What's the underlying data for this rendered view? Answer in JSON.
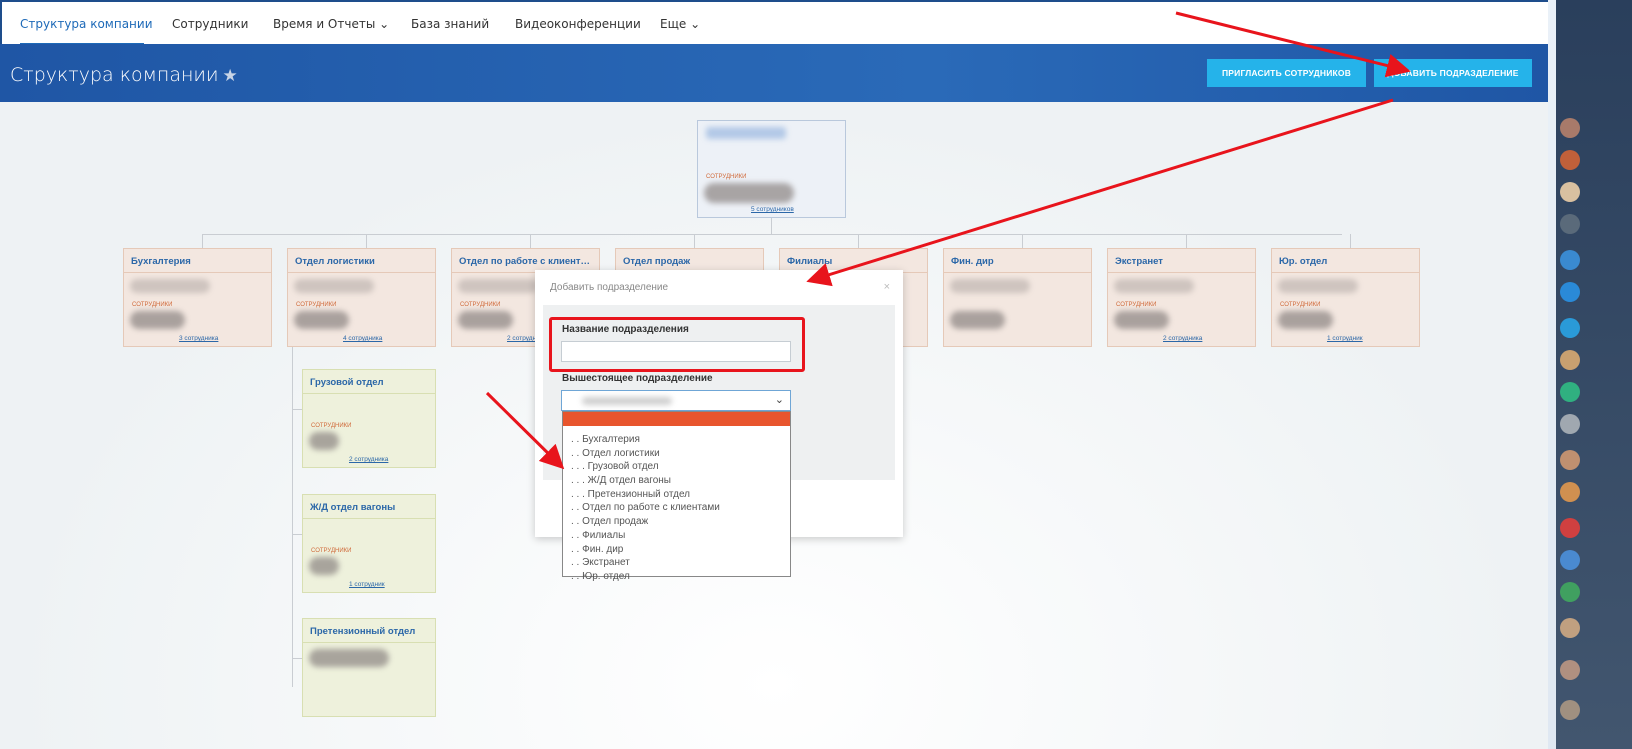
{
  "nav": {
    "items": [
      {
        "label": "Структура компании",
        "active": true
      },
      {
        "label": "Сотрудники"
      },
      {
        "label": "Время и Отчеты",
        "dropdown": true
      },
      {
        "label": "База знаний"
      },
      {
        "label": "Видеоконференции"
      },
      {
        "label": "Еще",
        "dropdown": true
      }
    ]
  },
  "header": {
    "title": "Структура компании",
    "star_icon": "star-icon",
    "invite_button": "ПРИГЛАСИТЬ СОТРУДНИКОВ",
    "add_button": "ДОБАВИТЬ ПОДРАЗДЕЛЕНИЕ",
    "button_color": "#25b3ea"
  },
  "org": {
    "root": {
      "label": "СОТРУДНИКИ",
      "count": "5 сотрудников"
    },
    "departments": [
      {
        "name": "Бухгалтерия",
        "label": "СОТРУДНИКИ",
        "count": "3 сотрудника"
      },
      {
        "name": "Отдел логистики",
        "label": "СОТРУДНИКИ",
        "count": "4 сотрудника"
      },
      {
        "name": "Отдел по работе с клиентами",
        "label": "СОТРУДНИКИ",
        "count": "2 сотрудника"
      },
      {
        "name": "Отдел продаж",
        "label": "",
        "count": ""
      },
      {
        "name": "Филиалы",
        "label": "",
        "count": ""
      },
      {
        "name": "Фин. дир",
        "label": "",
        "count": ""
      },
      {
        "name": "Экстранет",
        "label": "СОТРУДНИКИ",
        "count": "2 сотрудника"
      },
      {
        "name": "Юр. отдел",
        "label": "СОТРУДНИКИ",
        "count": "1 сотрудник"
      }
    ],
    "subdepartments": [
      {
        "name": "Грузовой отдел",
        "label": "СОТРУДНИКИ",
        "count": "2 сотрудника"
      },
      {
        "name": "Ж/Д отдел вагоны",
        "label": "СОТРУДНИКИ",
        "count": "1 сотрудник"
      },
      {
        "name": "Претензионный отдел",
        "label": "",
        "count": ""
      }
    ]
  },
  "modal": {
    "title": "Добавить подразделение",
    "close": "×",
    "name_label": "Название подразделения",
    "name_value": "",
    "parent_label": "Вышестоящее подразделение",
    "chevron": "⌄",
    "options": [
      ". . Бухгалтерия",
      ". . Отдел логистики",
      ". . . Грузовой отдел",
      ". . . Ж/Д отдел вагоны",
      ". . . Претензионный отдел",
      ". . Отдел по работе с клиентами",
      ". . Отдел продаж",
      ". . Филиалы",
      ". . Фин. дир",
      ". . Экстранет",
      ". . Юр. отдел"
    ],
    "selected_color": "#e8552d"
  },
  "annotation_color": "#e8141c"
}
